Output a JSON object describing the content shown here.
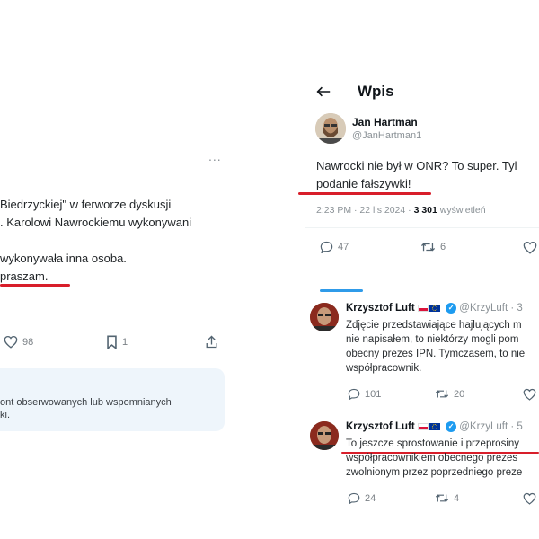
{
  "left_post": {
    "more": "...",
    "line1": "Biedrzyckiej\" w ferworze dyskusji",
    "line2": ". Karolowi Nawrockiemu wykonywani",
    "line3": "wykonywała inna osoba.",
    "line4": "praszam.",
    "likes": "98",
    "bookmarks": "1",
    "notice_line1": "ont obserwowanych lub wspomnianych",
    "notice_line2": "ki."
  },
  "right_post": {
    "header_title": "Wpis",
    "author_name": "Jan Hartman",
    "author_handle": "@JanHartman1",
    "text_line1": "Nawrocki nie był w ONR? To super. Tyl",
    "text_line2": "podanie fałszywki!",
    "timestamp": "2:23 PM · 22 lis 2024 ·",
    "views_count": "3 301",
    "views_label": "wyświetleń",
    "replies": "47",
    "reposts": "6"
  },
  "reply1": {
    "author_name": "Krzysztof Luft",
    "handle": "@KrzyLuft · 3",
    "line1": "Zdjęcie przedstawiające hajlujących m",
    "line2": "nie napisałem, to niektórzy mogli pom",
    "line3": "obecny prezes IPN. Tymczasem, to nie",
    "line4": "współpracownik.",
    "replies": "101",
    "reposts": "20"
  },
  "reply2": {
    "author_name": "Krzysztof Luft",
    "handle": "@KrzyLuft · 5",
    "line1": "To jeszcze sprostowanie i przeprosiny",
    "line2": "współpracownikiem obecnego prezes",
    "line3": "zwolnionym przez poprzedniego preze",
    "replies": "24",
    "reposts": "4"
  },
  "colors": {
    "underline": "#d81e2a",
    "thread_blue": "#2f9be9"
  }
}
